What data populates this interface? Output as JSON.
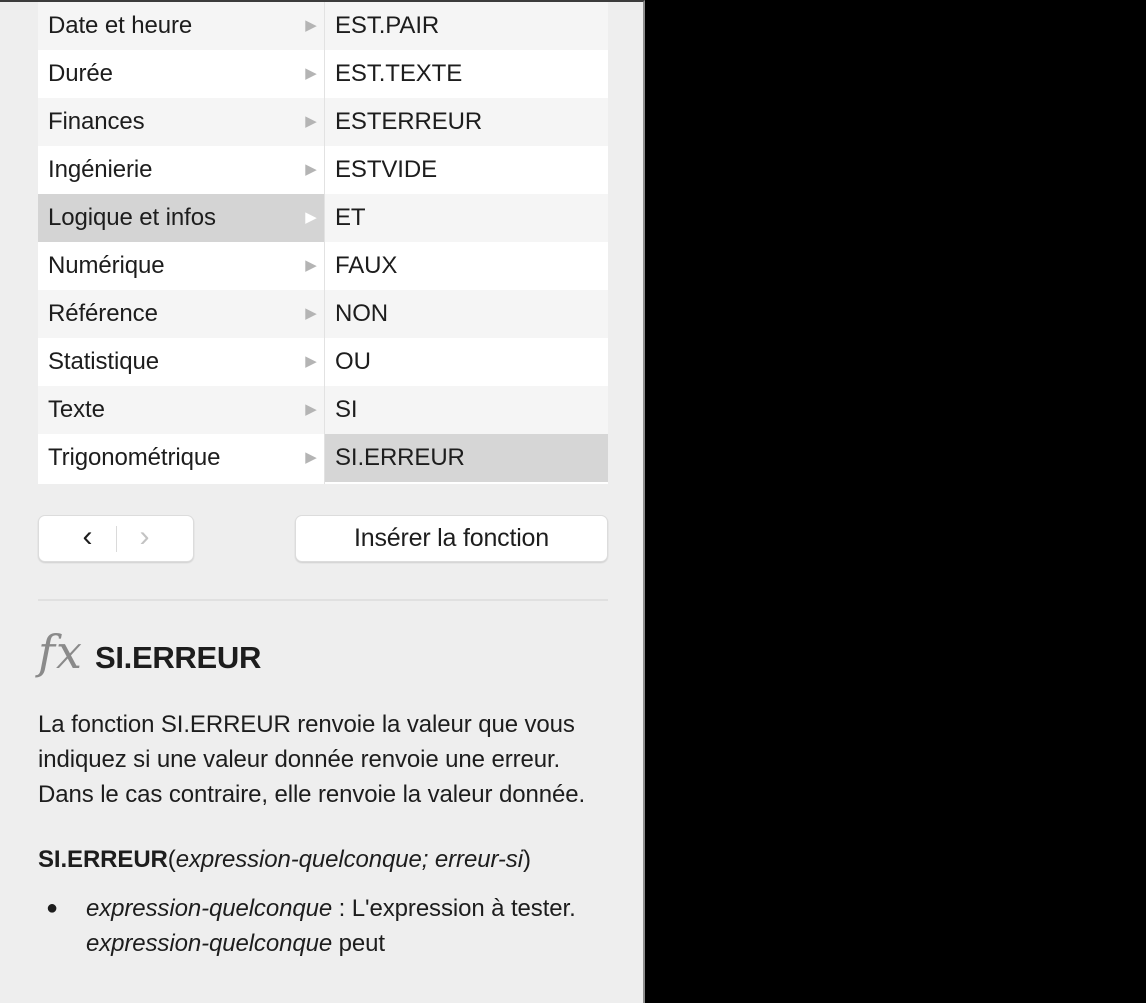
{
  "panel": {
    "background_color": "#eeeeee"
  },
  "browser": {
    "categories_header": "",
    "categories": [
      {
        "label": "Date et heure",
        "selected": false
      },
      {
        "label": "Durée",
        "selected": false
      },
      {
        "label": "Finances",
        "selected": false
      },
      {
        "label": "Ingénierie",
        "selected": false
      },
      {
        "label": "Logique et infos",
        "selected": true
      },
      {
        "label": "Numérique",
        "selected": false
      },
      {
        "label": "Référence",
        "selected": false
      },
      {
        "label": "Statistique",
        "selected": false
      },
      {
        "label": "Texte",
        "selected": false
      },
      {
        "label": "Trigonométrique",
        "selected": false
      }
    ],
    "functions": [
      {
        "label": "EST.PAIR",
        "selected": false
      },
      {
        "label": "EST.TEXTE",
        "selected": false
      },
      {
        "label": "ESTERREUR",
        "selected": false
      },
      {
        "label": "ESTVIDE",
        "selected": false
      },
      {
        "label": "ET",
        "selected": false
      },
      {
        "label": "FAUX",
        "selected": false
      },
      {
        "label": "NON",
        "selected": false
      },
      {
        "label": "OU",
        "selected": false
      },
      {
        "label": "SI",
        "selected": false
      },
      {
        "label": "SI.ERREUR",
        "selected": true
      }
    ],
    "disclosure_icon": "▶",
    "selection_color": "#d6d6d6"
  },
  "actions": {
    "back_icon": "‹",
    "forward_icon": "›",
    "back_enabled": true,
    "forward_enabled": false,
    "insert_label": "Insérer la fonction"
  },
  "detail": {
    "fx_icon": "fx",
    "function_name": "SI.ERREUR",
    "description": "La fonction SI.ERREUR renvoie la valeur que vous indiquez si une valeur donnée renvoie une erreur. Dans le cas contraire, elle renvoie la valeur donnée.",
    "syntax": {
      "name": "SI.ERREUR",
      "open_paren": "(",
      "arg1": "expression-quelconque",
      "separator": "; ",
      "arg2": "erreur-si",
      "close_paren": ")"
    },
    "bullet_icon": "●",
    "parameters": [
      {
        "name": "expression-quelconque",
        "colon": " : ",
        "text_before": "L'expression à tester. ",
        "name_repeat": "expression-quelconque",
        "text_after": " peut"
      }
    ]
  }
}
